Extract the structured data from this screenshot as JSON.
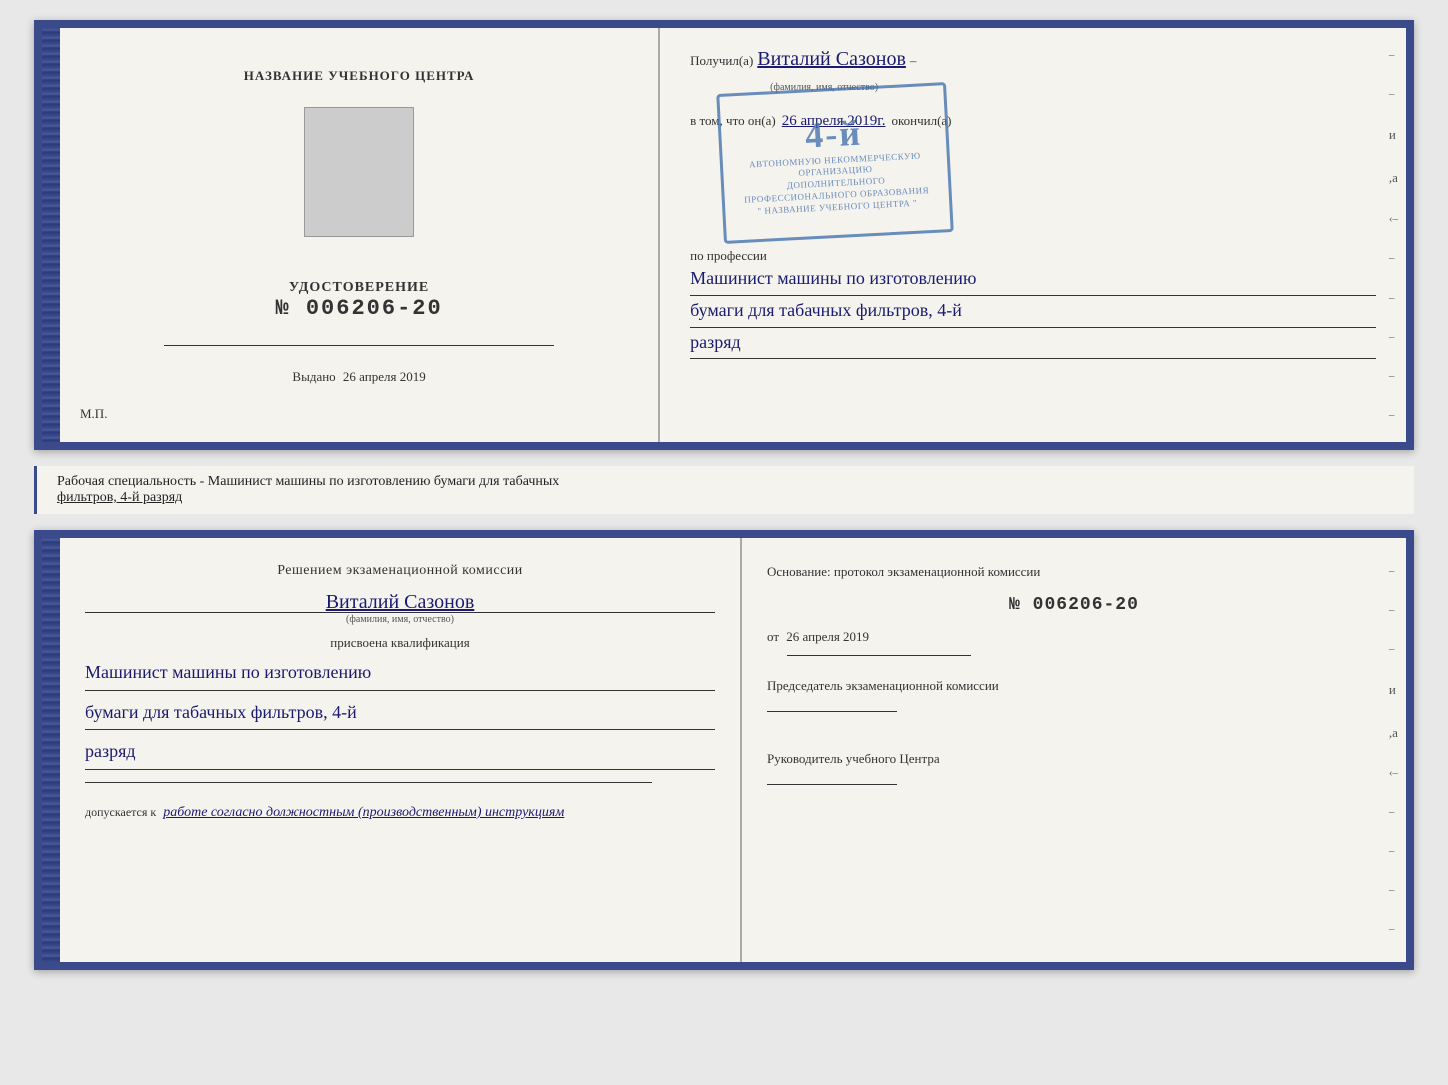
{
  "top_cert": {
    "left": {
      "title": "НАЗВАНИЕ УЧЕБНОГО ЦЕНТРА",
      "udost_label": "УДОСТОВЕРЕНИЕ",
      "udost_number": "№ 006206-20",
      "issued_label": "Выдано",
      "issued_date": "26 апреля 2019",
      "mp": "М.П."
    },
    "right": {
      "received_label": "Получил(а)",
      "fio": "Виталий Сазонов",
      "fio_sub": "(фамилия, имя, отчество)",
      "in_that_label": "в том, что он(а)",
      "date_handwritten": "26 апреля 2019г.",
      "finished_label": "окончил(а)",
      "stamp_big": "4-й",
      "stamp_line1": "АВТОНОМНУЮ НЕКОММЕРЧЕСКУЮ ОРГАНИЗАЦИЮ",
      "stamp_line2": "ДОПОЛНИТЕЛЬНОГО ПРОФЕССИОНАЛЬНОГО ОБРАЗОВАНИЯ",
      "stamp_line3": "\" НАЗВАНИЕ УЧЕБНОГО ЦЕНТРА \"",
      "profession_label": "по профессии",
      "profession_line1": "Машинист машины по изготовлению",
      "profession_line2": "бумаги для табачных фильтров, 4-й",
      "profession_line3": "разряд"
    }
  },
  "middle_label": {
    "prefix": "Рабочая специальность - Машинист машины по изготовлению бумаги для табачных",
    "underline": "фильтров, 4-й разряд"
  },
  "bottom_cert": {
    "left": {
      "section_title": "Решением  экзаменационной  комиссии",
      "fio": "Виталий Сазонов",
      "fio_sub": "(фамилия, имя, отчество)",
      "qual_label": "присвоена квалификация",
      "qual_line1": "Машинист машины по изготовлению",
      "qual_line2": "бумаги для табачных фильтров, 4-й",
      "qual_line3": "разряд",
      "допуск_prefix": "допускается к",
      "допуск_value": "работе согласно должностным (производственным) инструкциям"
    },
    "right": {
      "osnov_label": "Основание: протокол экзаменационной  комиссии",
      "protocol_number": "№  006206-20",
      "from_label": "от",
      "from_date": "26 апреля 2019",
      "chairman_label": "Председатель экзаменационной комиссии",
      "director_label": "Руководитель учебного Центра"
    }
  }
}
